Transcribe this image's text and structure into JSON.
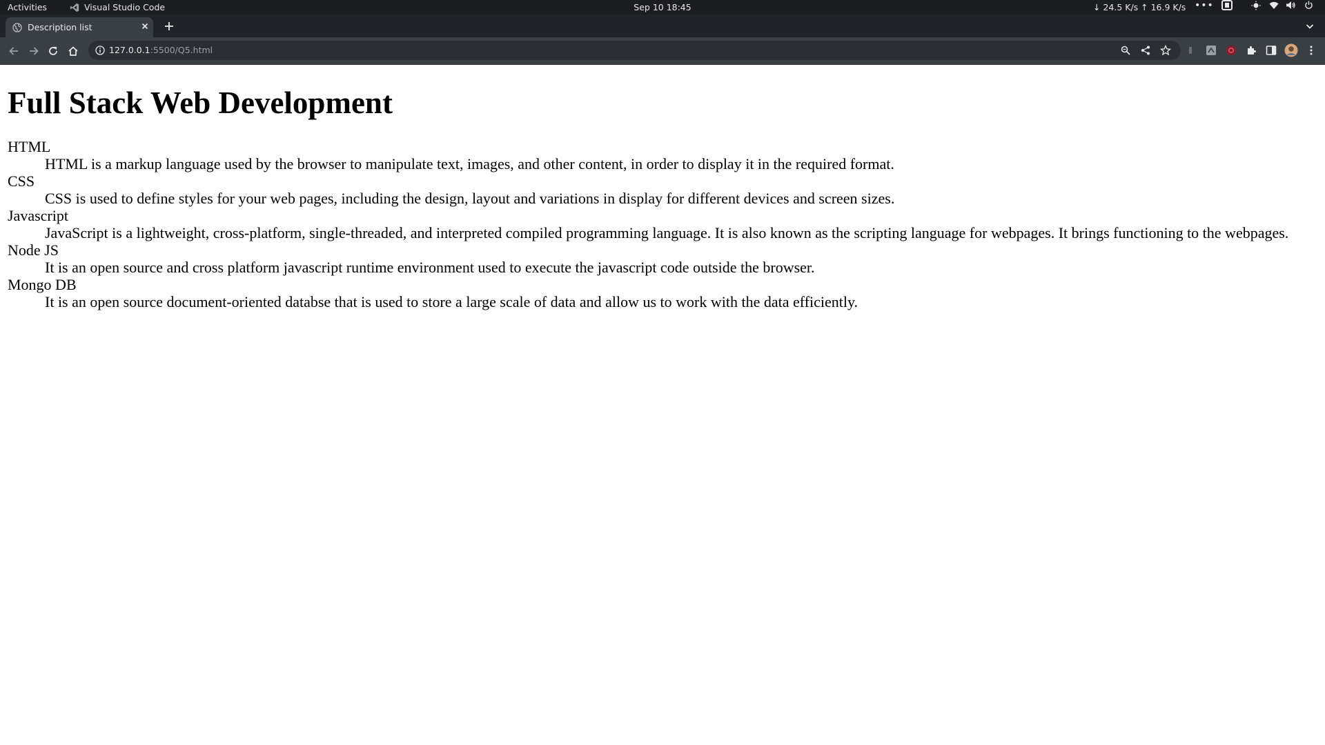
{
  "system_bar": {
    "activities": "Activities",
    "app_name": "Visual Studio Code",
    "clock": "Sep 10  18:45",
    "net_speed": "↓ 24.5 K/s ↑ 16.9 K/s",
    "more": "•••"
  },
  "browser": {
    "tab": {
      "title": "Description list"
    },
    "address_bar": {
      "host": "127.0.0.1",
      "path": ":5500/Q5.html"
    },
    "accent_color": "#e8eaed"
  },
  "page": {
    "heading": "Full Stack Web Development",
    "definitions": [
      {
        "term": "HTML",
        "description": "HTML is a markup language used by the browser to manipulate text, images, and other content, in order to display it in the required format."
      },
      {
        "term": "CSS",
        "description": "CSS is used to define styles for your web pages, including the design, layout and variations in display for different devices and screen sizes."
      },
      {
        "term": "Javascript",
        "description": "JavaScript is a lightweight, cross-platform, single-threaded, and interpreted compiled programming language. It is also known as the scripting language for webpages. It brings functioning to the webpages."
      },
      {
        "term": "Node JS",
        "description": "It is an open source and cross platform javascript runtime environment used to execute the javascript code outside the browser."
      },
      {
        "term": "Mongo DB",
        "description": "It is an open source document-oriented databse that is used to store a large scale of data and allow us to work with the data efficiently."
      }
    ]
  }
}
